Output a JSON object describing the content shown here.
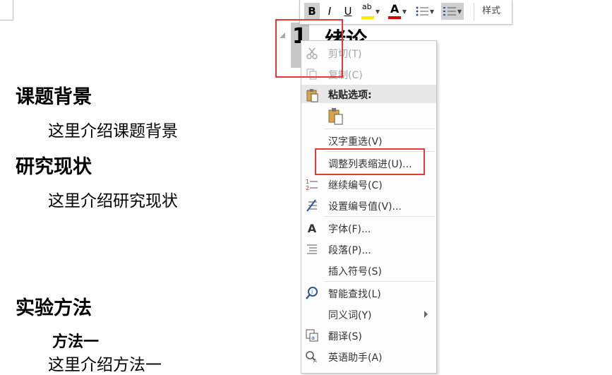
{
  "document": {
    "sections": [
      {
        "heading": "课题背景",
        "body": "这里介绍课题背景"
      },
      {
        "heading": "研究现状",
        "body": "这里介绍研究现状"
      },
      {
        "heading": "实验方法",
        "subheading": "方法一",
        "body": "这里介绍方法一"
      }
    ],
    "chapter_number": "1",
    "chapter_title": "绪论"
  },
  "mini_toolbar": {
    "bold": "B",
    "italic": "I",
    "underline": "U",
    "highlight_glyph": "ab",
    "font_color_glyph": "A",
    "styles_label": "样式",
    "highlight_color": "#ffeb00",
    "font_color": "#e00000"
  },
  "context_menu": {
    "cut": "剪切(T)",
    "copy": "复制(C)",
    "paste_options": "粘贴选项:",
    "reconvert": "汉字重选(V)",
    "adjust_list_indent": "调整列表缩进(U)...",
    "continue_numbering": "继续编号(C)",
    "set_numbering_value": "设置编号值(V)...",
    "font": "字体(F)...",
    "paragraph": "段落(P)...",
    "insert_symbol": "插入符号(S)",
    "smart_lookup": "智能查找(L)",
    "synonyms": "同义词(Y)",
    "translate": "翻译(S)",
    "english_assistant": "英语助手(A)",
    "icons": {
      "cut": "scissors-icon",
      "copy": "copy-icon",
      "paste": "clipboard-icon",
      "paste_keep": "paste-keep-text-icon",
      "continue_numbering": "continue-numbering-icon",
      "set_numbering_value": "set-numbering-value-icon",
      "font": "font-icon",
      "paragraph": "paragraph-icon",
      "smart_lookup": "smart-lookup-icon",
      "translate": "translate-icon",
      "english_assistant": "english-assistant-icon"
    }
  },
  "annotations": {
    "highlight_color": "#e53935"
  }
}
